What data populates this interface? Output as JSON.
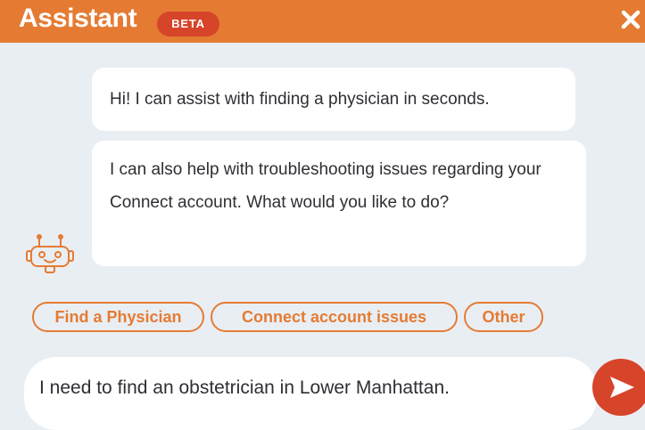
{
  "header": {
    "title": "Assistant",
    "badge": "BETA",
    "close_icon": "close-icon"
  },
  "messages": [
    {
      "sender": "bot",
      "text": "Hi! I can assist with finding a physician in seconds."
    },
    {
      "sender": "bot",
      "text": "I can also help with troubleshooting issues regarding your Connect account. What would you like to do?"
    }
  ],
  "bot_avatar": "robot-icon",
  "quick_replies": [
    {
      "label": "Find a Physician"
    },
    {
      "label": "Connect account issues"
    },
    {
      "label": "Other"
    }
  ],
  "composer": {
    "value": "I need to find an obstetrician in Lower Manhattan.",
    "send_icon": "send-icon"
  },
  "colors": {
    "accent": "#e57b33",
    "badge": "#d6442a",
    "send": "#d6442a",
    "background": "#e9eef3",
    "bubble": "#ffffff",
    "text": "#2d2f33"
  }
}
